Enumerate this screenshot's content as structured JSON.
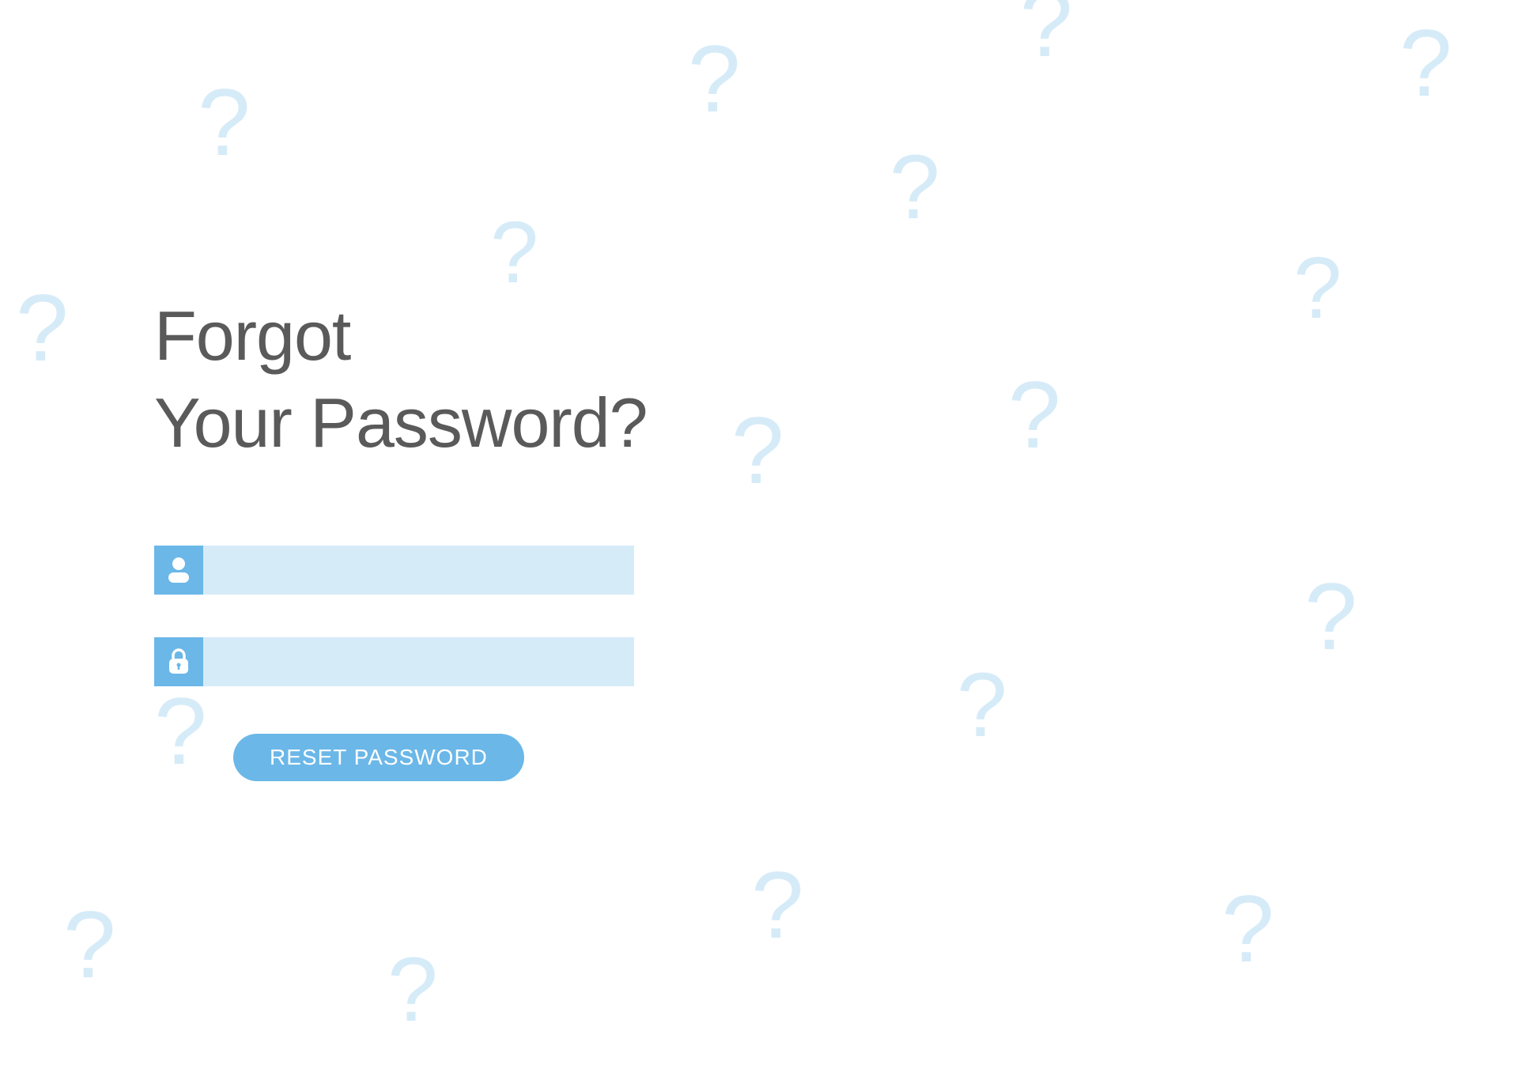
{
  "heading": {
    "line1": "Forgot",
    "line2": "Your Password?"
  },
  "form": {
    "username_value": "",
    "password_value": "",
    "reset_label": "RESET PASSWORD"
  },
  "colors": {
    "accent": "#6bb7e8",
    "input_bg": "#d6ebf8",
    "bg_qmark": "#d6ebf8",
    "heading_color": "#5a5a5a"
  }
}
